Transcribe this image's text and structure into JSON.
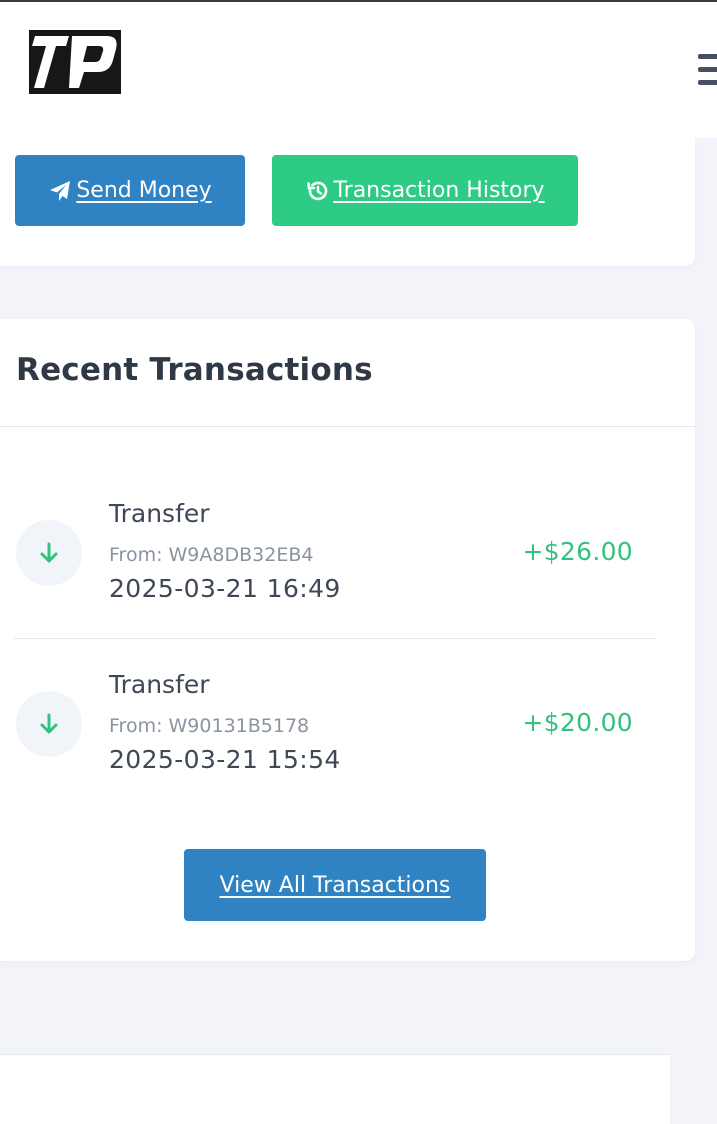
{
  "header": {
    "logo_text": "TP",
    "logo_icon": "brand-logo",
    "menu_icon": "hamburger-menu-icon"
  },
  "actions": {
    "send_money_label": "Send Money",
    "send_money_icon": "paper-plane-icon",
    "history_label": "Transaction History",
    "history_icon": "history-clock-icon"
  },
  "recent": {
    "title": "Recent Transactions",
    "transactions": [
      {
        "type": "Transfer",
        "from": "From: W9A8DB32EB4",
        "datetime": "2025-03-21 16:49",
        "amount": "+$26.00",
        "direction_icon": "arrow-down-icon"
      },
      {
        "type": "Transfer",
        "from": "From: W90131B5178",
        "datetime": "2025-03-21 15:54",
        "amount": "+$20.00",
        "direction_icon": "arrow-down-icon"
      }
    ],
    "view_all_label": "View All Transactions"
  },
  "colors": {
    "primary": "#2f83c3",
    "success": "#2ecb85",
    "amount_positive": "#34c17e",
    "background": "#f3f4f9"
  }
}
